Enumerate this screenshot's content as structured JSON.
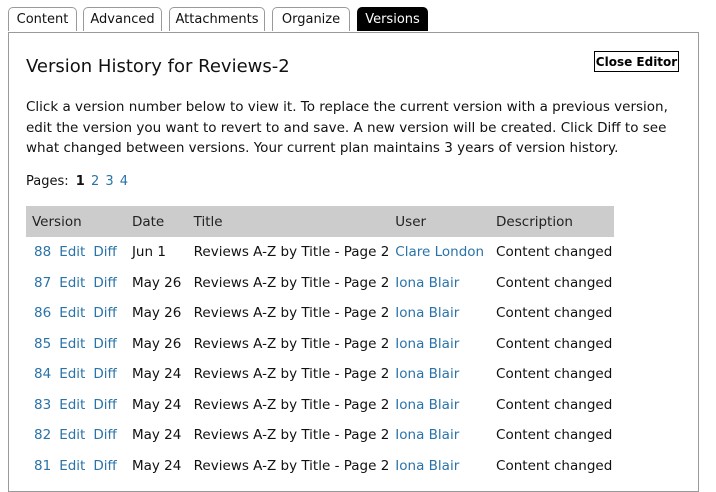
{
  "tabs": [
    {
      "label": "Content",
      "active": false
    },
    {
      "label": "Advanced",
      "active": false
    },
    {
      "label": "Attachments",
      "active": false
    },
    {
      "label": "Organize",
      "active": false
    },
    {
      "label": "Versions",
      "active": true
    }
  ],
  "header": {
    "title": "Version History for Reviews-2",
    "close_label": "Close Editor"
  },
  "intro_text": "Click a version number below to view it. To replace the current version with a previous version, edit the version you want to revert to and save. A new version will be created. Click Diff to see what changed between versions. Your current plan maintains 3 years of version history.",
  "pager": {
    "label": "Pages:",
    "current": "1",
    "others": [
      "2",
      "3",
      "4"
    ]
  },
  "table": {
    "columns": [
      "Version",
      "Date",
      "Title",
      "User",
      "Description"
    ],
    "edit_label": "Edit",
    "diff_label": "Diff",
    "rows": [
      {
        "version": "88",
        "date": "Jun 1",
        "title": "Reviews A-Z by Title - Page 2",
        "user": "Clare London",
        "description": "Content changed"
      },
      {
        "version": "87",
        "date": "May 26",
        "title": "Reviews A-Z by Title - Page 2",
        "user": "Iona Blair",
        "description": "Content changed"
      },
      {
        "version": "86",
        "date": "May 26",
        "title": "Reviews A-Z by Title - Page 2",
        "user": "Iona Blair",
        "description": "Content changed"
      },
      {
        "version": "85",
        "date": "May 26",
        "title": "Reviews A-Z by Title - Page 2",
        "user": "Iona Blair",
        "description": "Content changed"
      },
      {
        "version": "84",
        "date": "May 24",
        "title": "Reviews A-Z by Title - Page 2",
        "user": "Iona Blair",
        "description": "Content changed"
      },
      {
        "version": "83",
        "date": "May 24",
        "title": "Reviews A-Z by Title - Page 2",
        "user": "Iona Blair",
        "description": "Content changed"
      },
      {
        "version": "82",
        "date": "May 24",
        "title": "Reviews A-Z by Title - Page 2",
        "user": "Iona Blair",
        "description": "Content changed"
      },
      {
        "version": "81",
        "date": "May 24",
        "title": "Reviews A-Z by Title - Page 2",
        "user": "Iona Blair",
        "description": "Content changed"
      }
    ]
  },
  "colors": {
    "link": "#2a73a8",
    "active_tab": "#000000",
    "header_bg": "#cccccc"
  }
}
